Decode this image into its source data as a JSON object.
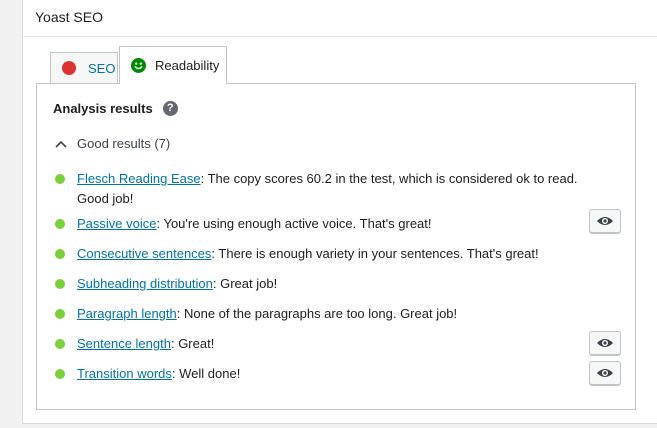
{
  "metabox": {
    "title": "Yoast SEO"
  },
  "tabs": [
    {
      "label": "SEO",
      "status_color": "#dc3232",
      "icon": "red-dot-icon"
    },
    {
      "label": "Readability",
      "status_color": "#008a00",
      "icon": "smiley-icon"
    }
  ],
  "analysis": {
    "heading": "Analysis results",
    "help_icon": "help-icon",
    "good_results_label": "Good results (7)",
    "bullet_color": "#7ad03a",
    "results": [
      {
        "link": "Flesch Reading Ease",
        "text": ": The copy scores 60.2 in the test, which is considered ok to read. Good job!",
        "has_eye": false
      },
      {
        "link": "Passive voice",
        "text": ": You're using enough active voice. That's great!",
        "has_eye": true
      },
      {
        "link": "Consecutive sentences",
        "text": ": There is enough variety in your sentences. That's great!",
        "has_eye": false
      },
      {
        "link": "Subheading distribution",
        "text": ": Great job!",
        "has_eye": false
      },
      {
        "link": "Paragraph length",
        "text": ": None of the paragraphs are too long. Great job!",
        "has_eye": false
      },
      {
        "link": "Sentence length",
        "text": ": Great!",
        "has_eye": true
      },
      {
        "link": "Transition words",
        "text": ": Well done!",
        "has_eye": true
      }
    ]
  }
}
